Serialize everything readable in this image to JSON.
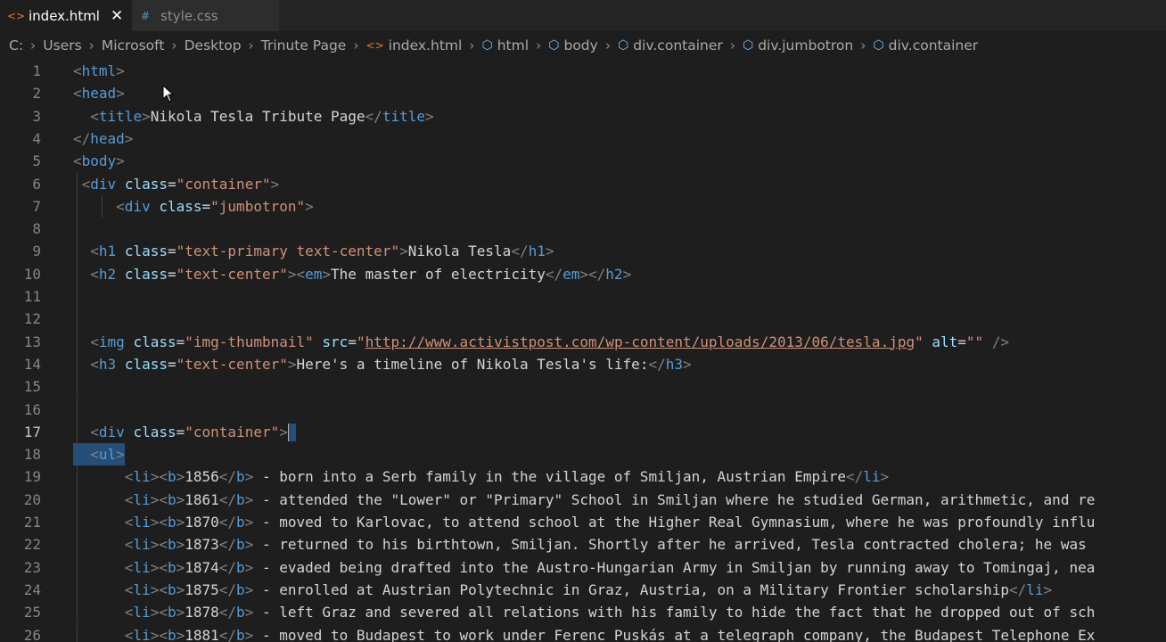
{
  "tabs": [
    {
      "label": "index.html",
      "icon": "html-file-icon",
      "active": true,
      "close": "✕"
    },
    {
      "label": "style.css",
      "icon": "css-file-icon",
      "active": false
    }
  ],
  "breadcrumb": [
    "C:",
    "Users",
    "Microsoft",
    "Desktop",
    "Trinute Page",
    "index.html",
    "html",
    "body",
    "div.container",
    "div.jumbotron",
    "div.container"
  ],
  "editor": {
    "current_line": 17,
    "lines": [
      {
        "n": "1",
        "segs": [
          [
            "t-br",
            "<"
          ],
          [
            "t-tag",
            "html"
          ],
          [
            "t-br",
            ">"
          ]
        ],
        "indent": 0
      },
      {
        "n": "2",
        "segs": [
          [
            "t-br",
            "<"
          ],
          [
            "t-tag",
            "head"
          ],
          [
            "t-br",
            ">"
          ]
        ],
        "indent": 0
      },
      {
        "n": "3",
        "segs": [
          [
            "t-br",
            "  <"
          ],
          [
            "t-tag",
            "title"
          ],
          [
            "t-br",
            ">"
          ],
          [
            "t-txt",
            "Nikola Tesla Tribute Page"
          ],
          [
            "t-br",
            "</"
          ],
          [
            "t-tag",
            "title"
          ],
          [
            "t-br",
            ">"
          ]
        ],
        "indent": 0
      },
      {
        "n": "4",
        "segs": [
          [
            "t-br",
            "</"
          ],
          [
            "t-tag",
            "head"
          ],
          [
            "t-br",
            ">"
          ]
        ],
        "indent": 0
      },
      {
        "n": "5",
        "segs": [
          [
            "t-br",
            "<"
          ],
          [
            "t-tag",
            "body"
          ],
          [
            "t-br",
            ">"
          ]
        ],
        "indent": 0
      },
      {
        "n": "6",
        "segs": [
          [
            "t-br",
            " <"
          ],
          [
            "t-tag",
            "div"
          ],
          [
            "t-txt",
            " "
          ],
          [
            "t-attr",
            "class"
          ],
          [
            "t-txt",
            "="
          ],
          [
            "t-str",
            "\"container\""
          ],
          [
            "t-br",
            ">"
          ]
        ],
        "indent": 0
      },
      {
        "n": "7",
        "segs": [
          [
            "t-br",
            "     <"
          ],
          [
            "t-tag",
            "div"
          ],
          [
            "t-txt",
            " "
          ],
          [
            "t-attr",
            "class"
          ],
          [
            "t-txt",
            "="
          ],
          [
            "t-str",
            "\"jumbotron\""
          ],
          [
            "t-br",
            ">"
          ]
        ],
        "indent": 0
      },
      {
        "n": "8",
        "segs": [],
        "indent": 0
      },
      {
        "n": "9",
        "segs": [
          [
            "t-br",
            "  <"
          ],
          [
            "t-tag",
            "h1"
          ],
          [
            "t-txt",
            " "
          ],
          [
            "t-attr",
            "class"
          ],
          [
            "t-txt",
            "="
          ],
          [
            "t-str",
            "\"text-primary text-center\""
          ],
          [
            "t-br",
            ">"
          ],
          [
            "t-txt",
            "Nikola Tesla"
          ],
          [
            "t-br",
            "</"
          ],
          [
            "t-tag",
            "h1"
          ],
          [
            "t-br",
            ">"
          ]
        ],
        "indent": 0
      },
      {
        "n": "10",
        "segs": [
          [
            "t-br",
            "  <"
          ],
          [
            "t-tag",
            "h2"
          ],
          [
            "t-txt",
            " "
          ],
          [
            "t-attr",
            "class"
          ],
          [
            "t-txt",
            "="
          ],
          [
            "t-str",
            "\"text-center\""
          ],
          [
            "t-br",
            "><"
          ],
          [
            "t-tag",
            "em"
          ],
          [
            "t-br",
            ">"
          ],
          [
            "t-txt",
            "The master of electricity"
          ],
          [
            "t-br",
            "</"
          ],
          [
            "t-tag",
            "em"
          ],
          [
            "t-br",
            "></"
          ],
          [
            "t-tag",
            "h2"
          ],
          [
            "t-br",
            ">"
          ]
        ],
        "indent": 0
      },
      {
        "n": "11",
        "segs": [],
        "indent": 0
      },
      {
        "n": "12",
        "segs": [],
        "indent": 0
      },
      {
        "n": "13",
        "segs": [
          [
            "t-br",
            "  <"
          ],
          [
            "t-tag",
            "img"
          ],
          [
            "t-txt",
            " "
          ],
          [
            "t-attr",
            "class"
          ],
          [
            "t-txt",
            "="
          ],
          [
            "t-str",
            "\"img-thumbnail\""
          ],
          [
            "t-txt",
            " "
          ],
          [
            "t-attr",
            "src"
          ],
          [
            "t-txt",
            "="
          ],
          [
            "t-str",
            "\""
          ],
          [
            "t-url",
            "http://www.activistpost.com/wp-content/uploads/2013/06/tesla.jpg"
          ],
          [
            "t-str",
            "\""
          ],
          [
            "t-txt",
            " "
          ],
          [
            "t-attr",
            "alt"
          ],
          [
            "t-txt",
            "="
          ],
          [
            "t-str",
            "\"\""
          ],
          [
            "t-br",
            " />"
          ]
        ],
        "indent": 0
      },
      {
        "n": "14",
        "segs": [
          [
            "t-br",
            "  <"
          ],
          [
            "t-tag",
            "h3"
          ],
          [
            "t-txt",
            " "
          ],
          [
            "t-attr",
            "class"
          ],
          [
            "t-txt",
            "="
          ],
          [
            "t-str",
            "\"text-center\""
          ],
          [
            "t-br",
            ">"
          ],
          [
            "t-txt",
            "Here's a timeline of Nikola Tesla's life:"
          ],
          [
            "t-br",
            "</"
          ],
          [
            "t-tag",
            "h3"
          ],
          [
            "t-br",
            ">"
          ]
        ],
        "indent": 0
      },
      {
        "n": "15",
        "segs": [],
        "indent": 0
      },
      {
        "n": "16",
        "segs": [],
        "indent": 0
      },
      {
        "n": "17",
        "segs": [
          [
            "t-br",
            "  <"
          ],
          [
            "t-tag",
            "div"
          ],
          [
            "t-txt",
            " "
          ],
          [
            "t-attr",
            "class"
          ],
          [
            "t-txt",
            "="
          ],
          [
            "t-str",
            "\"container\""
          ],
          [
            "t-br",
            ">"
          ]
        ],
        "indent": 0,
        "cursor": true
      },
      {
        "n": "18",
        "segs": [
          [
            "t-br",
            "  <"
          ],
          [
            "t-tag",
            "ul"
          ],
          [
            "t-br",
            ">"
          ]
        ],
        "indent": 0,
        "selected": true
      },
      {
        "n": "19",
        "segs": [
          [
            "t-br",
            "      <"
          ],
          [
            "t-tag",
            "li"
          ],
          [
            "t-br",
            "><"
          ],
          [
            "t-tag",
            "b"
          ],
          [
            "t-br",
            ">"
          ],
          [
            "t-txt",
            "1856"
          ],
          [
            "t-br",
            "</"
          ],
          [
            "t-tag",
            "b"
          ],
          [
            "t-br",
            ">"
          ],
          [
            "t-txt",
            " - born into a Serb family in the village of Smiljan, Austrian Empire"
          ],
          [
            "t-br",
            "</"
          ],
          [
            "t-tag",
            "li"
          ],
          [
            "t-br",
            ">"
          ]
        ],
        "indent": 0
      },
      {
        "n": "20",
        "segs": [
          [
            "t-br",
            "      <"
          ],
          [
            "t-tag",
            "li"
          ],
          [
            "t-br",
            "><"
          ],
          [
            "t-tag",
            "b"
          ],
          [
            "t-br",
            ">"
          ],
          [
            "t-txt",
            "1861"
          ],
          [
            "t-br",
            "</"
          ],
          [
            "t-tag",
            "b"
          ],
          [
            "t-br",
            ">"
          ],
          [
            "t-txt",
            " - attended the \"Lower\" or \"Primary\" School in Smiljan where he studied German, arithmetic, and re"
          ]
        ],
        "indent": 0
      },
      {
        "n": "21",
        "segs": [
          [
            "t-br",
            "      <"
          ],
          [
            "t-tag",
            "li"
          ],
          [
            "t-br",
            "><"
          ],
          [
            "t-tag",
            "b"
          ],
          [
            "t-br",
            ">"
          ],
          [
            "t-txt",
            "1870"
          ],
          [
            "t-br",
            "</"
          ],
          [
            "t-tag",
            "b"
          ],
          [
            "t-br",
            ">"
          ],
          [
            "t-txt",
            " - moved to Karlovac, to attend school at the Higher Real Gymnasium, where he was profoundly influ"
          ]
        ],
        "indent": 0
      },
      {
        "n": "22",
        "segs": [
          [
            "t-br",
            "      <"
          ],
          [
            "t-tag",
            "li"
          ],
          [
            "t-br",
            "><"
          ],
          [
            "t-tag",
            "b"
          ],
          [
            "t-br",
            ">"
          ],
          [
            "t-txt",
            "1873"
          ],
          [
            "t-br",
            "</"
          ],
          [
            "t-tag",
            "b"
          ],
          [
            "t-br",
            ">"
          ],
          [
            "t-txt",
            " - returned to his birthtown, Smiljan. Shortly after he arrived, Tesla contracted cholera; he was "
          ]
        ],
        "indent": 0
      },
      {
        "n": "23",
        "segs": [
          [
            "t-br",
            "      <"
          ],
          [
            "t-tag",
            "li"
          ],
          [
            "t-br",
            "><"
          ],
          [
            "t-tag",
            "b"
          ],
          [
            "t-br",
            ">"
          ],
          [
            "t-txt",
            "1874"
          ],
          [
            "t-br",
            "</"
          ],
          [
            "t-tag",
            "b"
          ],
          [
            "t-br",
            ">"
          ],
          [
            "t-txt",
            " - evaded being drafted into the Austro-Hungarian Army in Smiljan by running away to Tomingaj, nea"
          ]
        ],
        "indent": 0
      },
      {
        "n": "24",
        "segs": [
          [
            "t-br",
            "      <"
          ],
          [
            "t-tag",
            "li"
          ],
          [
            "t-br",
            "><"
          ],
          [
            "t-tag",
            "b"
          ],
          [
            "t-br",
            ">"
          ],
          [
            "t-txt",
            "1875"
          ],
          [
            "t-br",
            "</"
          ],
          [
            "t-tag",
            "b"
          ],
          [
            "t-br",
            ">"
          ],
          [
            "t-txt",
            " - enrolled at Austrian Polytechnic in Graz, Austria, on a Military Frontier scholarship"
          ],
          [
            "t-br",
            "</"
          ],
          [
            "t-tag",
            "li"
          ],
          [
            "t-br",
            ">"
          ]
        ],
        "indent": 0
      },
      {
        "n": "25",
        "segs": [
          [
            "t-br",
            "      <"
          ],
          [
            "t-tag",
            "li"
          ],
          [
            "t-br",
            "><"
          ],
          [
            "t-tag",
            "b"
          ],
          [
            "t-br",
            ">"
          ],
          [
            "t-txt",
            "1878"
          ],
          [
            "t-br",
            "</"
          ],
          [
            "t-tag",
            "b"
          ],
          [
            "t-br",
            ">"
          ],
          [
            "t-txt",
            " - left Graz and severed all relations with his family to hide the fact that he dropped out of sch"
          ]
        ],
        "indent": 0
      },
      {
        "n": "26",
        "segs": [
          [
            "t-br",
            "      <"
          ],
          [
            "t-tag",
            "li"
          ],
          [
            "t-br",
            "><"
          ],
          [
            "t-tag",
            "b"
          ],
          [
            "t-br",
            ">"
          ],
          [
            "t-txt",
            "1881"
          ],
          [
            "t-br",
            "</"
          ],
          [
            "t-tag",
            "b"
          ],
          [
            "t-br",
            ">"
          ],
          [
            "t-txt",
            " - moved to Budapest to work under Ferenc Puskás at a telegraph company, the Budapest Telephone Ex"
          ]
        ],
        "indent": 0
      }
    ]
  }
}
